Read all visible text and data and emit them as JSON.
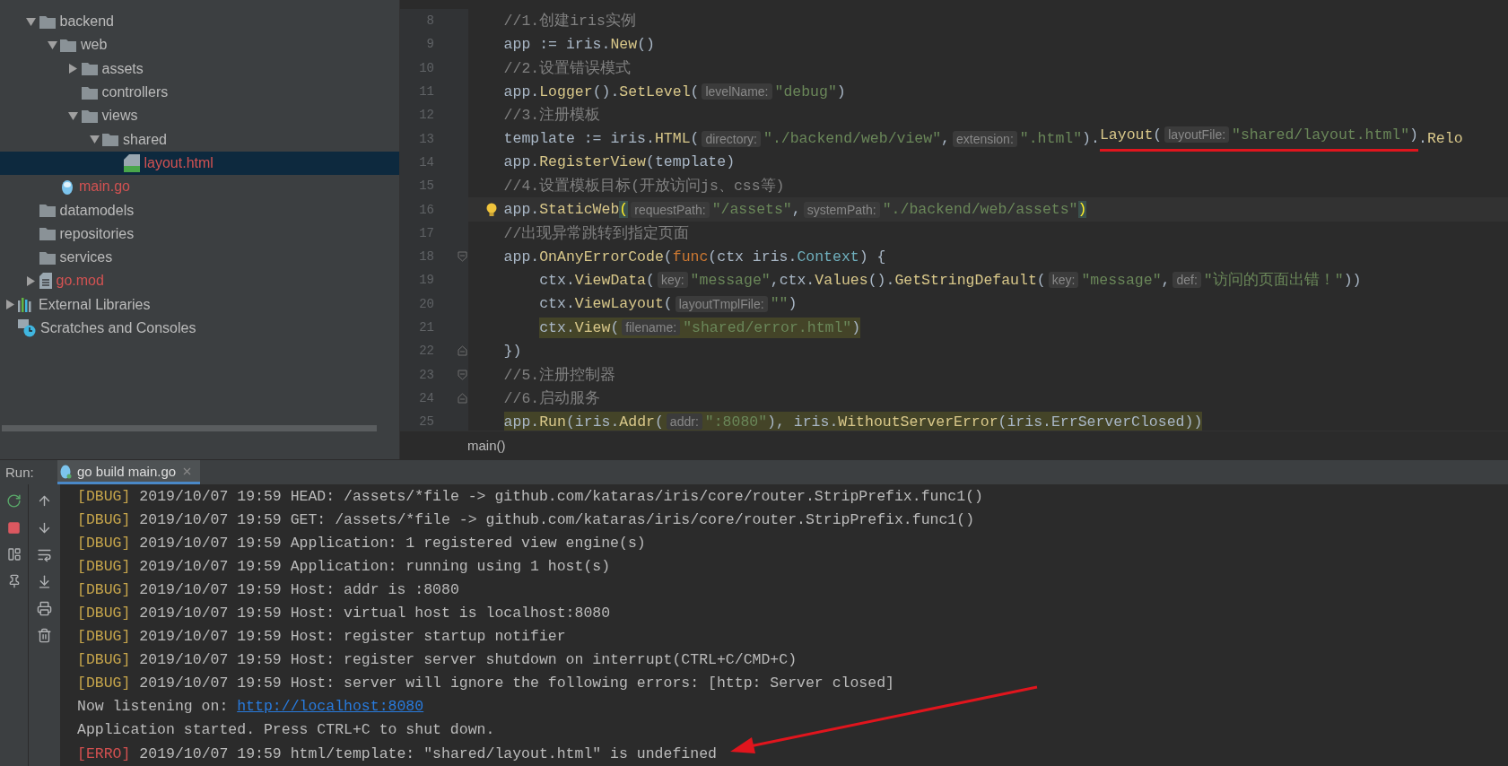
{
  "project_tree": {
    "items": [
      {
        "label": "backend",
        "kind": "folder",
        "color": "#bbbbbb",
        "expanded": true,
        "selected": false,
        "children": [
          {
            "label": "web",
            "kind": "folder",
            "color": "#bbbbbb",
            "expanded": true,
            "selected": false,
            "children": [
              {
                "label": "assets",
                "kind": "folder",
                "color": "#bbbbbb",
                "expanded": false,
                "selected": false
              },
              {
                "label": "controllers",
                "kind": "folder",
                "color": "#bbbbbb",
                "selected": false
              },
              {
                "label": "views",
                "kind": "folder",
                "color": "#bbbbbb",
                "expanded": true,
                "selected": false,
                "children": [
                  {
                    "label": "shared",
                    "kind": "folder",
                    "color": "#bbbbbb",
                    "expanded": true,
                    "selected": false,
                    "children": [
                      {
                        "label": "layout.html",
                        "kind": "html",
                        "color": "#d25252",
                        "selected": true
                      }
                    ]
                  }
                ]
              }
            ]
          },
          {
            "label": "main.go",
            "kind": "go",
            "color": "#d25252",
            "selected": false
          }
        ]
      },
      {
        "label": "datamodels",
        "kind": "folder",
        "color": "#bbbbbb",
        "selected": false
      },
      {
        "label": "repositories",
        "kind": "folder",
        "color": "#bbbbbb",
        "selected": false
      },
      {
        "label": "services",
        "kind": "folder",
        "color": "#bbbbbb",
        "selected": false
      },
      {
        "label": "go.mod",
        "kind": "mod",
        "color": "#d25252",
        "expanded": false,
        "selected": false
      }
    ],
    "roots": [
      {
        "label": "External Libraries",
        "kind": "library",
        "color": "#bbbbbb",
        "expanded": false,
        "selected": false
      },
      {
        "label": "Scratches and Consoles",
        "kind": "scratch",
        "color": "#bbbbbb",
        "selected": false
      }
    ]
  },
  "editor": {
    "lines": [
      {
        "number": "8",
        "tokens": [
          {
            "kind": "comment",
            "text": "//1.创建iris实例"
          }
        ]
      },
      {
        "number": "9",
        "tokens": [
          {
            "kind": "plain",
            "text": "app := iris."
          },
          {
            "kind": "fn",
            "text": "New"
          },
          {
            "kind": "plain",
            "text": "()"
          }
        ]
      },
      {
        "number": "10",
        "tokens": [
          {
            "kind": "comment",
            "text": "//2.设置错误模式"
          }
        ]
      },
      {
        "number": "11",
        "tokens": [
          {
            "kind": "plain",
            "text": "app."
          },
          {
            "kind": "fn",
            "text": "Logger"
          },
          {
            "kind": "plain",
            "text": "()."
          },
          {
            "kind": "fn",
            "text": "SetLevel"
          },
          {
            "kind": "plain",
            "text": "("
          },
          {
            "kind": "hint",
            "text": "levelName:"
          },
          {
            "kind": "str",
            "text": "\"debug\""
          },
          {
            "kind": "plain",
            "text": ")"
          }
        ]
      },
      {
        "number": "12",
        "tokens": [
          {
            "kind": "comment",
            "text": "//3.注册模板"
          }
        ]
      },
      {
        "number": "13",
        "tokens": [
          {
            "kind": "plain",
            "text": "template := iris."
          },
          {
            "kind": "fn",
            "text": "HTML"
          },
          {
            "kind": "plain",
            "text": "("
          },
          {
            "kind": "hint",
            "text": "directory:"
          },
          {
            "kind": "str",
            "text": "\"./backend/web/view\""
          },
          {
            "kind": "plain",
            "text": ","
          },
          {
            "kind": "hint",
            "text": "extension:"
          },
          {
            "kind": "str",
            "text": "\".html\""
          },
          {
            "kind": "plain",
            "text": ")."
          },
          {
            "kind": "underline",
            "children": [
              {
                "kind": "fn",
                "text": "Layout"
              },
              {
                "kind": "plain",
                "text": "("
              },
              {
                "kind": "hint",
                "text": "layoutFile:"
              },
              {
                "kind": "str",
                "text": "\"shared/layout.html\""
              },
              {
                "kind": "plain",
                "text": ")"
              }
            ]
          },
          {
            "kind": "plain",
            "text": "."
          },
          {
            "kind": "fn",
            "text": "Relo"
          }
        ]
      },
      {
        "number": "14",
        "tokens": [
          {
            "kind": "plain",
            "text": "app."
          },
          {
            "kind": "fn",
            "text": "RegisterView"
          },
          {
            "kind": "plain",
            "text": "(template)"
          }
        ]
      },
      {
        "number": "15",
        "tokens": [
          {
            "kind": "comment",
            "text": "//4.设置模板目标(开放访问js、css等)"
          }
        ]
      },
      {
        "number": "16",
        "current": true,
        "tokens": [
          {
            "kind": "plain",
            "text": "app."
          },
          {
            "kind": "fn",
            "text": "StaticWeb"
          },
          {
            "kind": "brace",
            "text": "("
          },
          {
            "kind": "hint",
            "text": "requestPath:"
          },
          {
            "kind": "str",
            "text": "\"/assets\""
          },
          {
            "kind": "plain",
            "text": ","
          },
          {
            "kind": "hint",
            "text": "systemPath:"
          },
          {
            "kind": "str",
            "text": "\"./backend/web/assets\""
          },
          {
            "kind": "brace",
            "text": ")"
          }
        ]
      },
      {
        "number": "17",
        "tokens": [
          {
            "kind": "comment",
            "text": "//出现异常跳转到指定页面"
          }
        ]
      },
      {
        "number": "18",
        "kind": "fold_start",
        "tokens": [
          {
            "kind": "plain",
            "text": "app."
          },
          {
            "kind": "fn",
            "text": "OnAnyErrorCode"
          },
          {
            "kind": "plain",
            "text": "("
          },
          {
            "kind": "kw",
            "text": "func"
          },
          {
            "kind": "plain",
            "text": "(ctx iris."
          },
          {
            "kind": "type",
            "text": "Context"
          },
          {
            "kind": "plain",
            "text": ") {"
          }
        ],
        "children": [
          {
            "number": "19",
            "tokens": [
              {
                "kind": "plain",
                "text": "ctx."
              },
              {
                "kind": "fn",
                "text": "ViewData"
              },
              {
                "kind": "plain",
                "text": "("
              },
              {
                "kind": "hint",
                "text": "key:"
              },
              {
                "kind": "str",
                "text": "\"message\""
              },
              {
                "kind": "plain",
                "text": ",ctx."
              },
              {
                "kind": "fn",
                "text": "Values"
              },
              {
                "kind": "plain",
                "text": "()."
              },
              {
                "kind": "fn",
                "text": "GetStringDefault"
              },
              {
                "kind": "plain",
                "text": "("
              },
              {
                "kind": "hint",
                "text": "key:"
              },
              {
                "kind": "str",
                "text": "\"message\""
              },
              {
                "kind": "plain",
                "text": ","
              },
              {
                "kind": "hint",
                "text": "def:"
              },
              {
                "kind": "str",
                "text": "\"访问的页面出错！\""
              },
              {
                "kind": "plain",
                "text": "))"
              }
            ]
          },
          {
            "number": "20",
            "tokens": [
              {
                "kind": "plain",
                "text": "ctx."
              },
              {
                "kind": "fn",
                "text": "ViewLayout"
              },
              {
                "kind": "plain",
                "text": "("
              },
              {
                "kind": "hint",
                "text": "layoutTmplFile:"
              },
              {
                "kind": "str",
                "text": "\"\""
              },
              {
                "kind": "plain",
                "text": ")"
              }
            ]
          },
          {
            "number": "21",
            "tokens": [
              {
                "kind": "highlight",
                "children": [
                  {
                    "kind": "plain",
                    "text": "ctx."
                  },
                  {
                    "kind": "fn",
                    "text": "View"
                  },
                  {
                    "kind": "plain",
                    "text": "("
                  },
                  {
                    "kind": "hint",
                    "text": "filename:"
                  },
                  {
                    "kind": "str",
                    "text": "\"shared/error.html\""
                  },
                  {
                    "kind": "plain",
                    "text": ")"
                  }
                ]
              }
            ]
          }
        ]
      },
      {
        "number": "22",
        "kind": "fold_end",
        "tokens": [
          {
            "kind": "plain",
            "text": "})"
          }
        ]
      },
      {
        "number": "23",
        "kind": "fold_start",
        "tokens": [
          {
            "kind": "comment",
            "text": "//5.注册控制器"
          }
        ]
      },
      {
        "number": "24",
        "kind": "fold_end",
        "tokens": [
          {
            "kind": "comment",
            "text": "//6.启动服务"
          }
        ]
      },
      {
        "number": "25",
        "tokens": [
          {
            "kind": "highlight",
            "children": [
              {
                "kind": "plain",
                "text": "app."
              },
              {
                "kind": "fn",
                "text": "Run"
              },
              {
                "kind": "plain",
                "text": "(iris."
              },
              {
                "kind": "fn",
                "text": "Addr"
              },
              {
                "kind": "plain",
                "text": "("
              },
              {
                "kind": "hint",
                "text": "addr:"
              },
              {
                "kind": "str",
                "text": "\":8080\""
              },
              {
                "kind": "plain",
                "text": "), iris."
              },
              {
                "kind": "fn",
                "text": "WithoutServerError"
              },
              {
                "kind": "plain",
                "text": "(iris.ErrServerClosed))"
              }
            ]
          }
        ]
      }
    ],
    "breadcrumb": "main()"
  },
  "run_panel": {
    "label": "Run:",
    "tab": {
      "title": "go build main.go",
      "selected": true
    },
    "lines": [
      {
        "kind": "debug",
        "prefix": "[DBUG]",
        "text": "2019/10/07 19:59 HEAD: /assets/*file -> github.com/kataras/iris/core/router.StripPrefix.func1()"
      },
      {
        "kind": "debug",
        "prefix": "[DBUG]",
        "text": "2019/10/07 19:59 GET: /assets/*file -> github.com/kataras/iris/core/router.StripPrefix.func1()"
      },
      {
        "kind": "debug",
        "prefix": "[DBUG]",
        "text": "2019/10/07 19:59 Application: 1 registered view engine(s)"
      },
      {
        "kind": "debug",
        "prefix": "[DBUG]",
        "text": "2019/10/07 19:59 Application: running using 1 host(s)"
      },
      {
        "kind": "debug",
        "prefix": "[DBUG]",
        "text": "2019/10/07 19:59 Host: addr is :8080"
      },
      {
        "kind": "debug",
        "prefix": "[DBUG]",
        "text": "2019/10/07 19:59 Host: virtual host is localhost:8080"
      },
      {
        "kind": "debug",
        "prefix": "[DBUG]",
        "text": "2019/10/07 19:59 Host: register startup notifier"
      },
      {
        "kind": "debug",
        "prefix": "[DBUG]",
        "text": "2019/10/07 19:59 Host: register server shutdown on interrupt(CTRL+C/CMD+C)"
      },
      {
        "kind": "debug",
        "prefix": "[DBUG]",
        "text": "2019/10/07 19:59 Host: server will ignore the following errors: [http: Server closed]"
      },
      {
        "kind": "link",
        "text": "Now listening on:",
        "url": "http://localhost:8080"
      },
      {
        "kind": "info",
        "text": "Application started. Press CTRL+C to shut down."
      },
      {
        "kind": "error",
        "prefix": "[ERRO]",
        "text": "2019/10/07 19:59 html/template: \"shared/layout.html\" is undefined"
      }
    ]
  }
}
